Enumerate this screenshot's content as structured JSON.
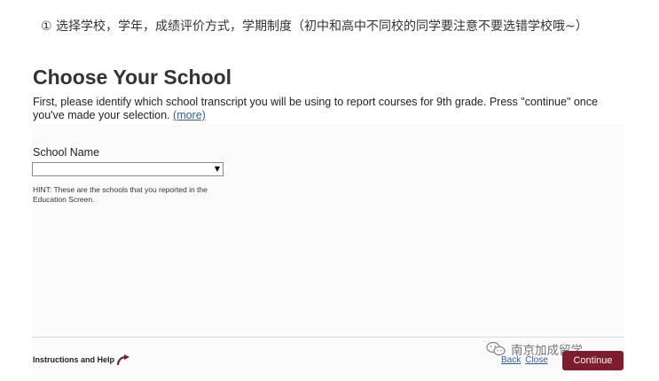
{
  "note": {
    "text": "① 选择学校，学年，成绩评价方式，学期制度（初中和高中不同校的同学要注意不要选错学校哦~）"
  },
  "page": {
    "title": "Choose Your School",
    "intro": "First, please identify which school transcript you will be using to report courses for 9th grade. Press \"continue\" once you've made your selection. ",
    "more_link": "(more)"
  },
  "form": {
    "school_label": "School Name",
    "school_value": "",
    "hint": "HINT: These are the schools that you reported in the Education Screen."
  },
  "footer": {
    "help_label": "Instructions and Help",
    "back_label": "Back",
    "close_label": "Close",
    "continue_label": "Continue"
  },
  "watermark": {
    "text": "南京加成留学"
  },
  "colors": {
    "continue_button": "#7e1d2e",
    "link": "#2a5db0"
  }
}
